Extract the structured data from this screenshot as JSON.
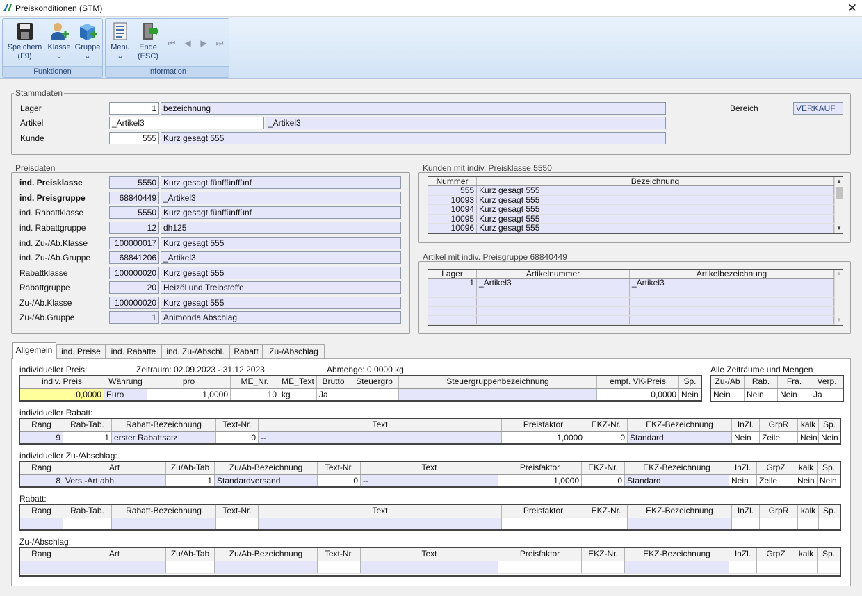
{
  "window": {
    "title": "Preiskonditionen (STM)",
    "close_glyph": "✕"
  },
  "ribbon": {
    "groups": [
      {
        "label": "Funktionen"
      },
      {
        "label": "Information"
      }
    ],
    "buttons": [
      {
        "label": "Speichern",
        "sub": "(F9)",
        "icon": "save-icon"
      },
      {
        "label": "Klasse",
        "sub": "⌄",
        "icon": "user-add-icon"
      },
      {
        "label": "Gruppe",
        "sub": "⌄",
        "icon": "cube-add-icon"
      },
      {
        "label": "Menu",
        "sub": "⌄",
        "icon": "menu-list-icon"
      },
      {
        "label": "Ende",
        "sub": "(ESC)",
        "icon": "exit-door-icon"
      }
    ]
  },
  "stammdaten": {
    "legend": "Stammdaten",
    "lager": {
      "label": "Lager",
      "value": "1",
      "desc": "bezeichnung"
    },
    "artikel": {
      "label": "Artikel",
      "value": "_Artikel3",
      "desc": "_Artikel3"
    },
    "kunde": {
      "label": "Kunde",
      "value": "555",
      "desc": "Kurz gesagt 555"
    },
    "bereich": {
      "label": "Bereich",
      "value": "VERKAUF"
    }
  },
  "preisdaten": {
    "legend": "Preisdaten",
    "rows": [
      {
        "label": "ind. Preisklasse",
        "value": "5550",
        "desc": "Kurz gesagt fünffünffünf"
      },
      {
        "label": "ind. Preisgruppe",
        "value": "68840449",
        "desc": "_Artikel3"
      },
      {
        "label": "ind. Rabattklasse",
        "value": "5550",
        "desc": "Kurz gesagt fünffünffünf"
      },
      {
        "label": "ind. Rabattgruppe",
        "value": "12",
        "desc": "dh125"
      },
      {
        "label": "ind. Zu-/Ab.Klasse",
        "value": "100000017",
        "desc": "Kurz gesagt 555"
      },
      {
        "label": "ind. Zu-/Ab.Gruppe",
        "value": "68841206",
        "desc": "_Artikel3"
      },
      {
        "label": "Rabattklasse",
        "value": "100000020",
        "desc": "Kurz gesagt 555"
      },
      {
        "label": "Rabattgruppe",
        "value": "20",
        "desc": "Heizöl und Treibstoffe"
      },
      {
        "label": "Zu-/Ab.Klasse",
        "value": "100000020",
        "desc": "Kurz gesagt 555"
      },
      {
        "label": "Zu-/Ab.Gruppe",
        "value": "1",
        "desc": "Animonda Abschlag"
      }
    ]
  },
  "kunden": {
    "legend": "Kunden mit indiv. Preisklasse 5550",
    "headers": [
      "Nummer",
      "Bezeichnung"
    ],
    "rows": [
      [
        "555",
        "Kurz gesagt 555"
      ],
      [
        "10093",
        "Kurz gesagt 555"
      ],
      [
        "10094",
        "Kurz gesagt 555"
      ],
      [
        "10095",
        "Kurz gesagt 555"
      ],
      [
        "10096",
        "Kurz gesagt 555"
      ]
    ]
  },
  "artikel_grid": {
    "legend": "Artikel mit indiv. Preisgruppe 68840449",
    "headers": [
      "Lager",
      "Artikelnummer",
      "Artikelbezeichnung"
    ],
    "rows": [
      [
        "1",
        "_Artikel3",
        "_Artikel3"
      ]
    ]
  },
  "tabs": [
    "Allgemein",
    "ind. Preise",
    "ind. Rabatte",
    "ind. Zu-/Abschl.",
    "Rabatt",
    "Zu-/Abschlag"
  ],
  "allgemein": {
    "preis_title": "individueller Preis:",
    "zeitraum": "Zeitraum: 02.09.2023 - 31.12.2023",
    "abmenge": "Abmenge: 0,0000 kg",
    "alle_title": "Alle Zeiträume und Mengen",
    "preis_headers": [
      "indiv. Preis",
      "Währung",
      "pro",
      "ME_Nr.",
      "ME_Text",
      "Brutto",
      "Steuergrp",
      "Steuergruppenbezeichnung",
      "empf. VK-Preis",
      "Sp."
    ],
    "preis_row": [
      "0,0000",
      "Euro",
      "1,0000",
      "10",
      "kg",
      "Ja",
      "",
      "",
      "0,0000",
      "Nein"
    ],
    "alle_headers": [
      "Zu-/Ab",
      "Rab.",
      "Fra.",
      "Verp."
    ],
    "alle_row": [
      "Nein",
      "Nein",
      "Nein",
      "Ja"
    ],
    "rabatt_title": "individueller Rabatt:",
    "rabatt_headers": [
      "Rang",
      "Rab-Tab.",
      "Rabatt-Bezeichnung",
      "Text-Nr.",
      "Text",
      "Preisfaktor",
      "EKZ-Nr.",
      "EKZ-Bezeichnung",
      "InZl.",
      "GrpR",
      "kalk",
      "Sp."
    ],
    "rabatt_row": [
      "9",
      "1",
      "erster Rabattsatz",
      "0",
      "--",
      "1,0000",
      "0",
      "Standard",
      "Nein",
      "Zeile",
      "Nein",
      "Nein"
    ],
    "zuab_title": "individueller Zu-/Abschlag:",
    "zuab_headers": [
      "Rang",
      "Art",
      "Zu/Ab-Tab",
      "Zu/Ab-Bezeichnung",
      "Text-Nr.",
      "Text",
      "Preisfaktor",
      "EKZ-Nr.",
      "EKZ-Bezeichnung",
      "InZl.",
      "GrpZ",
      "kalk",
      "Sp."
    ],
    "zuab_row": [
      "8",
      "Vers.-Art abh.",
      "1",
      "Standardversand",
      "0",
      "--",
      "1,0000",
      "0",
      "Standard",
      "Nein",
      "Zeile",
      "Nein",
      "Nein"
    ],
    "rabatt2_title": "Rabatt:",
    "zuab2_title": "Zu-/Abschlag:"
  }
}
